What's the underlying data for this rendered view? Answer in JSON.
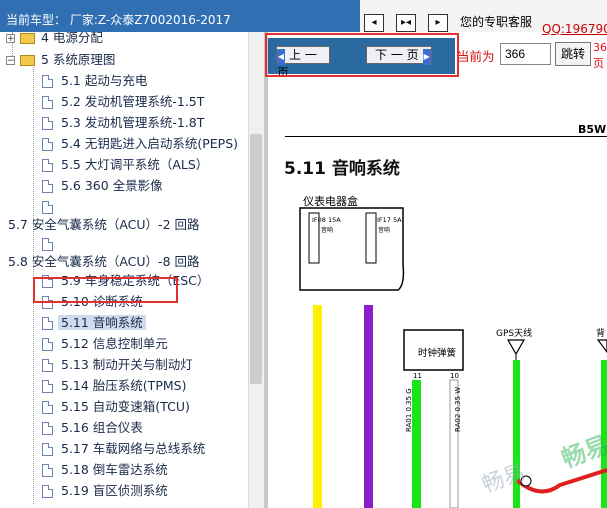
{
  "header": {
    "vehicle_label": "当前车型：  厂家:Z-众泰Z7002016-2017"
  },
  "topright": {
    "service_text": "您的专职客服",
    "qq_text": "QQ:196790"
  },
  "toolbar": {
    "prev_label": "上 一 页",
    "next_label": "下 一 页",
    "current_label": "当前为",
    "page_value": "366",
    "go_label": "跳转",
    "trailing_top": "36",
    "trailing_bottom": "页"
  },
  "sidebar": {
    "items": [
      {
        "label": "4 电源分配"
      },
      {
        "label": "5 系统原理图"
      },
      {
        "label": "5.1 起动与充电"
      },
      {
        "label": "5.2 发动机管理系统-1.5T"
      },
      {
        "label": "5.3 发动机管理系统-1.8T"
      },
      {
        "label": "5.4 无钥匙进入启动系统(PEPS)"
      },
      {
        "label": "5.5 大灯调平系统（ALS）"
      },
      {
        "label": "5.6 360 全景影像"
      },
      {
        "label": "5.7 安全气囊系统（ACU）-2 回路"
      },
      {
        "label": "5.8 安全气囊系统（ACU）-8 回路"
      },
      {
        "label": "5.9 车身稳定系统（ESC）"
      },
      {
        "label": "5.10 诊断系统"
      },
      {
        "label": "5.11 音响系统"
      },
      {
        "label": "5.12 信息控制单元"
      },
      {
        "label": "5.13 制动开关与制动灯"
      },
      {
        "label": "5.14 胎压系统(TPMS)"
      },
      {
        "label": "5.15 自动变速箱(TCU)"
      },
      {
        "label": "5.16 组合仪表"
      },
      {
        "label": "5.17 车载网络与总线系统"
      },
      {
        "label": "5.18 倒车雷达系统"
      },
      {
        "label": "5.19 盲区侦测系统"
      }
    ]
  },
  "document": {
    "header_code": "B5W",
    "section_title": "5.11 音响系统",
    "diagram": {
      "box_label": "仪表电器盒",
      "fuse1_id": "IF08 15A",
      "fuse1_sub": "音响",
      "fuse2_id": "IF17 5A",
      "fuse2_sub": "音响",
      "clock_label": "时钟弹簧",
      "pin_left": "11",
      "pin_right": "10",
      "wire1": "RA01 0.35 G",
      "wire2": "RA02 0.35 W",
      "gps_label": "GPS天线",
      "back_label": "背",
      "watermark1": "畅易",
      "watermark2": "畅易"
    }
  }
}
